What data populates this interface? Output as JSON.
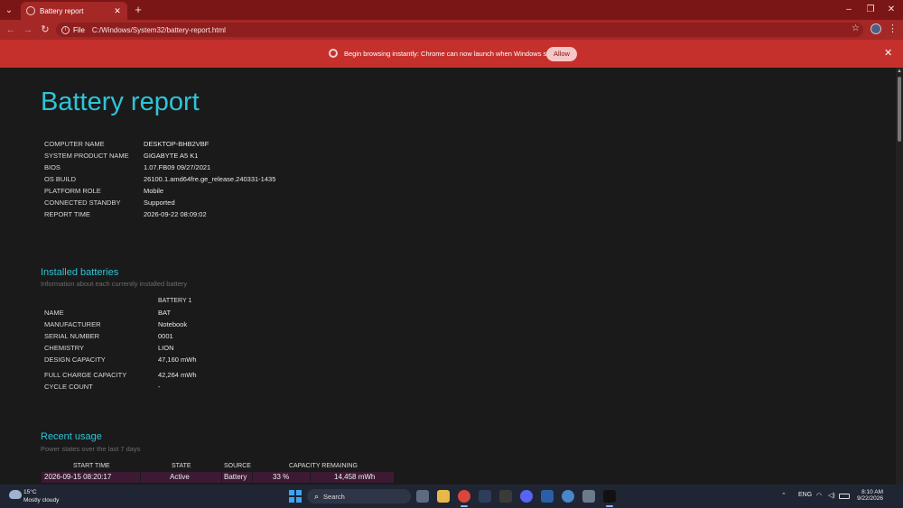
{
  "browser": {
    "tab_title": "Battery report",
    "address_scheme": "File",
    "address_url": "C:/Windows/System32/battery-report.html",
    "infobar_text": "Begin browsing instantly: Chrome can now launch when Windows starts.",
    "allow_label": "Allow",
    "colors": {
      "tabstrip": "#7a1716",
      "toolbar": "#a32826",
      "infobar": "#c5302d"
    }
  },
  "report": {
    "title": "Battery report",
    "system_info": [
      {
        "key": "COMPUTER NAME",
        "value": "DESKTOP-BHB2VBF"
      },
      {
        "key": "SYSTEM PRODUCT NAME",
        "value": "GIGABYTE A5 K1"
      },
      {
        "key": "BIOS",
        "value": "1.07.FB09 09/27/2021"
      },
      {
        "key": "OS BUILD",
        "value": "26100.1.amd64fre.ge_release.240331-1435"
      },
      {
        "key": "PLATFORM ROLE",
        "value": "Mobile"
      },
      {
        "key": "CONNECTED STANDBY",
        "value": "Supported"
      },
      {
        "key": "REPORT TIME",
        "value": "2026-09-22  08:09:02"
      }
    ],
    "installed_batteries": {
      "heading": "Installed batteries",
      "subheading": "Information about each currently installed battery",
      "column": "BATTERY 1",
      "rows": [
        {
          "key": "NAME",
          "value": "BAT"
        },
        {
          "key": "MANUFACTURER",
          "value": "Notebook"
        },
        {
          "key": "SERIAL NUMBER",
          "value": "0001"
        },
        {
          "key": "CHEMISTRY",
          "value": "LION"
        },
        {
          "key": "DESIGN CAPACITY",
          "value": "47,160 mWh"
        },
        {
          "key": "FULL CHARGE CAPACITY",
          "value": "42,264 mWh"
        },
        {
          "key": "CYCLE COUNT",
          "value": "-"
        }
      ]
    },
    "recent_usage": {
      "heading": "Recent usage",
      "subheading": "Power states over the last 7 days",
      "columns": [
        "START TIME",
        "STATE",
        "SOURCE",
        "CAPACITY REMAINING"
      ],
      "rows": [
        {
          "start": "2026-09-15  08:20:17",
          "state": "Active",
          "source": "Battery",
          "percent": "33 %",
          "mwh": "14,458 mWh"
        }
      ],
      "row_color": "#3c1a34"
    }
  },
  "taskbar": {
    "temp": "15°C",
    "condition": "Mostly cloudy",
    "search_label": "Search",
    "lang": "ENG",
    "time": "8:10 AM",
    "date": "9/22/2026"
  }
}
